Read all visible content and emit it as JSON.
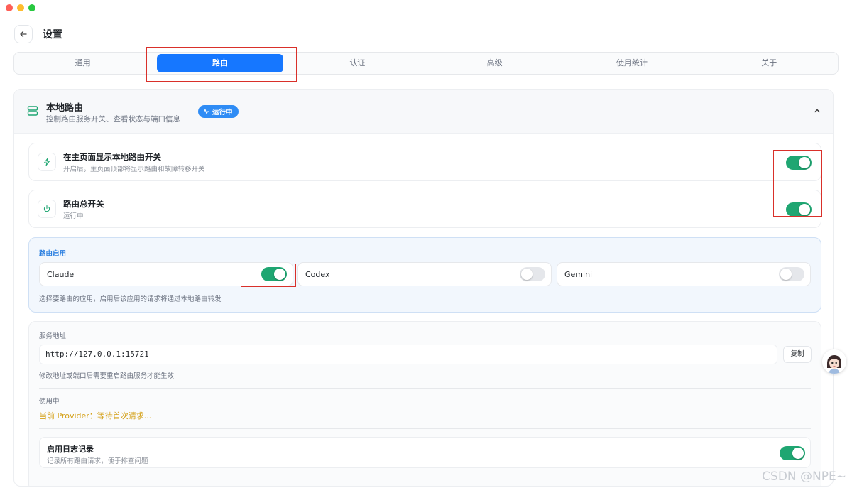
{
  "header": {
    "title": "设置"
  },
  "tabs": [
    {
      "label": "通用"
    },
    {
      "label": "路由"
    },
    {
      "label": "认证"
    },
    {
      "label": "高级"
    },
    {
      "label": "使用统计"
    },
    {
      "label": "关于"
    }
  ],
  "active_tab": "路由",
  "local_route": {
    "title": "本地路由",
    "subtitle": "控制路由服务开关、查看状态与端口信息",
    "badge": "运行中",
    "show_toggle": {
      "title": "在主页面显示本地路由开关",
      "description": "开启后，主页面顶部将显示路由和故障转移开关",
      "enabled": true
    },
    "master_switch": {
      "title": "路由总开关",
      "status": "运行中",
      "enabled": true
    }
  },
  "route_apps": {
    "label": "路由启用",
    "apps": [
      {
        "name": "Claude",
        "enabled": true
      },
      {
        "name": "Codex",
        "enabled": false
      },
      {
        "name": "Gemini",
        "enabled": false
      }
    ],
    "hint": "选择要路由的应用，启用后该应用的请求将通过本地路由转发"
  },
  "service": {
    "address_label": "服务地址",
    "address": "http://127.0.0.1:15721",
    "copy_label": "复制",
    "address_hint": "修改地址或端口后需要重启路由服务才能生效",
    "in_use_label": "使用中",
    "provider_text": "当前 Provider：等待首次请求...",
    "logging": {
      "title": "启用日志记录",
      "description": "记录所有路由请求，便于排查问题",
      "enabled": true
    }
  },
  "watermark": "CSDN @NPE~",
  "colors": {
    "accent_blue": "#1677ff",
    "toggle_on": "#1fa672",
    "highlight_red": "#d9302a",
    "provider_gold": "#d4a017"
  }
}
